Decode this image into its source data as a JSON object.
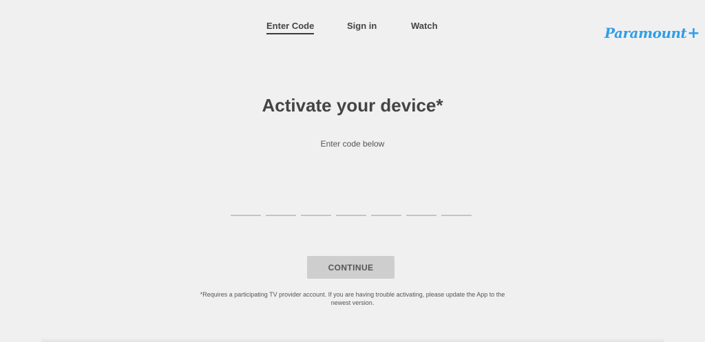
{
  "nav": {
    "items": [
      {
        "label": "Enter Code",
        "active": true
      },
      {
        "label": "Sign in",
        "active": false
      },
      {
        "label": "Watch",
        "active": false
      }
    ]
  },
  "logo": {
    "text": "Paramount",
    "plus": "+",
    "color": "#2f9ee8"
  },
  "main": {
    "title": "Activate your device*",
    "subtitle": "Enter code below",
    "code_slots": [
      "",
      "",
      "",
      "",
      "",
      "",
      ""
    ],
    "continue_label": "CONTINUE",
    "footnote": "*Requires a participating TV provider account. If you are having trouble activating, please update the App to the newest version."
  },
  "colors": {
    "background": "#f0f0f0",
    "button": "#cecece",
    "slot_underline": "#c4c4c4"
  }
}
